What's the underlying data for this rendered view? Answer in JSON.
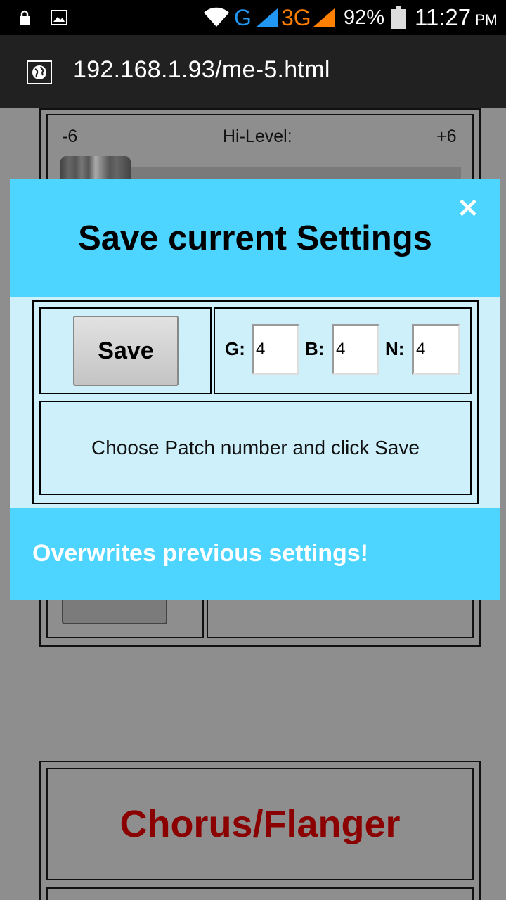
{
  "status_bar": {
    "network_1": "G",
    "network_2": "3G",
    "battery": "92%",
    "time": "11:27",
    "ampm": "PM",
    "icons": [
      "lock-icon",
      "image-icon",
      "wifi-icon",
      "signal-icon",
      "signal-icon",
      "battery-icon"
    ]
  },
  "browser": {
    "url": "192.168.1.93/me-5.html",
    "icon": "globe-icon"
  },
  "background_page": {
    "slider": {
      "min_label": "-6",
      "label": "Hi-Level:",
      "max_label": "+6"
    },
    "section_title": "Chorus/Flanger"
  },
  "modal": {
    "title": "Save current Settings",
    "close_symbol": "×",
    "save_label": "Save",
    "fields": [
      {
        "label": "G:",
        "value": "4"
      },
      {
        "label": "B:",
        "value": "4"
      },
      {
        "label": "N:",
        "value": "4"
      }
    ],
    "message": "Choose Patch number and click Save",
    "footer": "Overwrites previous settings!"
  },
  "colors": {
    "modal_header": "#4dd5ff",
    "modal_body": "#cdf0fb",
    "overlay": "#8e8e8e",
    "accent_title": "#8b0000"
  }
}
